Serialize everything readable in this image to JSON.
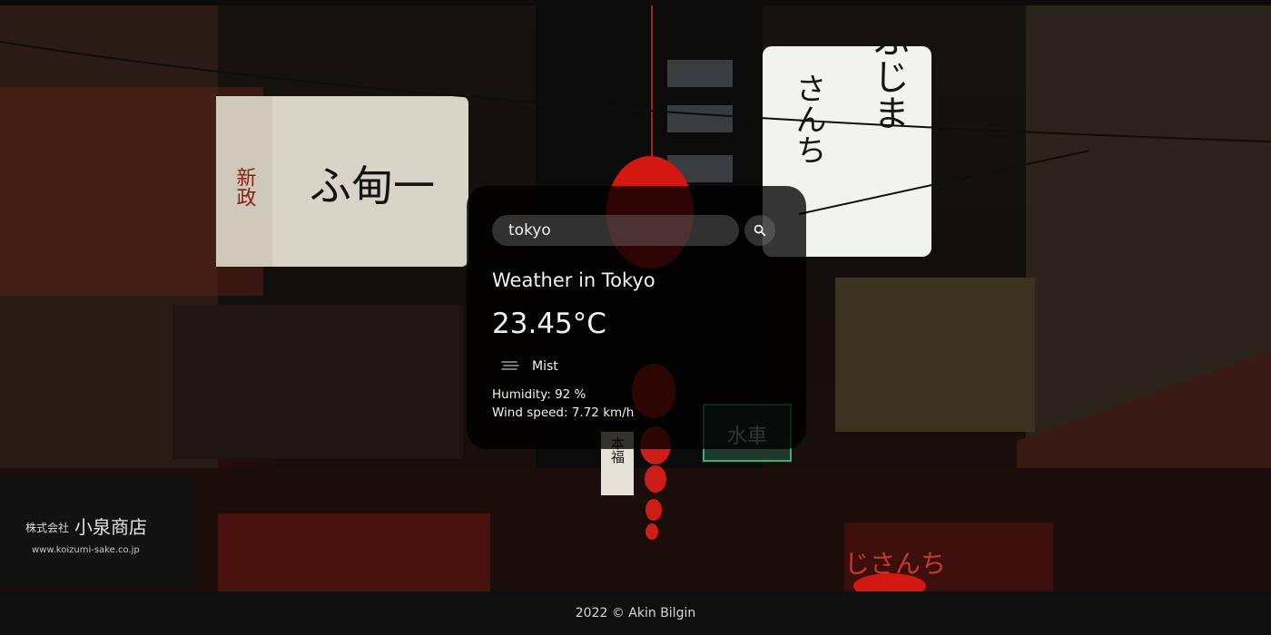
{
  "search": {
    "value": "tokyo",
    "placeholder": "Search"
  },
  "weather": {
    "title": "Weather in Tokyo",
    "temperature": "23.45°C",
    "icon": "mist-icon",
    "description": "Mist",
    "humidity": "Humidity: 92 %",
    "wind": "Wind speed: 7.72 km/h"
  },
  "background": {
    "signs": {
      "left_main": "ふ甸一",
      "left_side": "新政",
      "right_main": "ふじま",
      "right_sub": "さんち",
      "shop_left_small": "株式会社",
      "shop_left_name": "小泉商店",
      "shop_left_url": "www.koizumi-sake.co.jp",
      "green": "水車",
      "small_1": "本福",
      "bottom_right": "じさんち"
    }
  },
  "footer": {
    "text": "2022 © Akin Bilgin"
  }
}
